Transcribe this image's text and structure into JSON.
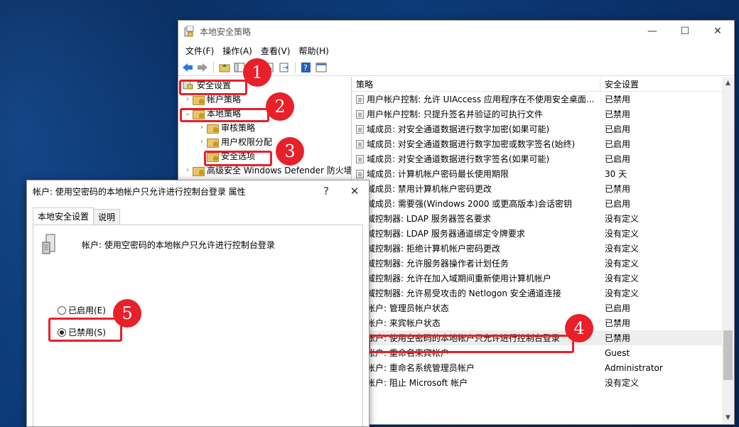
{
  "window": {
    "title": "本地安全策略",
    "minimize": "—",
    "maximize": "☐",
    "close": "✕"
  },
  "menu": [
    "文件(F)",
    "操作(A)",
    "查看(V)",
    "帮助(H)"
  ],
  "tree": {
    "root": "安全设置",
    "account_policy": "帐户策略",
    "local_policy": "本地策略",
    "audit_policy": "审核策略",
    "user_rights": "用户权限分配",
    "security_options": "安全选项",
    "firewall": "高级安全 Windows Defender 防火墙"
  },
  "list": {
    "header_policy": "策略",
    "header_setting": "安全设置",
    "rows": [
      {
        "policy": "用户帐户控制: 允许 UIAccess 应用程序在不使用安全桌面...",
        "setting": "已禁用"
      },
      {
        "policy": "用户帐户控制: 只提升签名并验证的可执行文件",
        "setting": "已禁用"
      },
      {
        "policy": "域成员: 对安全通道数据进行数字加密(如果可能)",
        "setting": "已启用"
      },
      {
        "policy": "域成员: 对安全通道数据进行数字加密或数字签名(始终)",
        "setting": "已启用"
      },
      {
        "policy": "域成员: 对安全通道数据进行数字签名(如果可能)",
        "setting": "已启用"
      },
      {
        "policy": "域成员: 计算机帐户密码最长使用期限",
        "setting": "30 天"
      },
      {
        "policy": "域成员: 禁用计算机帐户密码更改",
        "setting": "已禁用"
      },
      {
        "policy": "域成员: 需要强(Windows 2000 或更高版本)会话密钥",
        "setting": "已启用"
      },
      {
        "policy": "域控制器: LDAP 服务器签名要求",
        "setting": "没有定义"
      },
      {
        "policy": "域控制器: LDAP 服务器通道绑定令牌要求",
        "setting": "没有定义"
      },
      {
        "policy": "域控制器: 拒绝计算机帐户密码更改",
        "setting": "没有定义"
      },
      {
        "policy": "域控制器: 允许服务器操作者计划任务",
        "setting": "没有定义"
      },
      {
        "policy": "域控制器:  允许在加入域期间重新使用计算机帐户",
        "setting": "没有定义"
      },
      {
        "policy": "域控制器:  允许易受攻击的 Netlogon 安全通道连接",
        "setting": "没有定义"
      },
      {
        "policy": "帐户: 管理员帐户状态",
        "setting": "已启用"
      },
      {
        "policy": "帐户: 来宾帐户状态",
        "setting": "已禁用"
      },
      {
        "policy": "帐户: 使用空密码的本地帐户只允许进行控制台登录",
        "setting": "已禁用"
      },
      {
        "policy": "帐户: 重命名来宾帐户",
        "setting": "Guest"
      },
      {
        "policy": "帐户: 重命名系统管理员帐户",
        "setting": "Administrator"
      },
      {
        "policy": "帐户: 阻止 Microsoft 帐户",
        "setting": "没有定义"
      }
    ]
  },
  "dialog": {
    "title": "帐户: 使用空密码的本地帐户只允许进行控制台登录 属性",
    "help": "?",
    "close": "✕",
    "tab_local": "本地安全设置",
    "tab_explain": "说明",
    "description": "帐户: 使用空密码的本地帐户只允许进行控制台登录",
    "option_enabled": "已启用(E)",
    "option_disabled": "已禁用(S)",
    "selected": "option_disabled"
  },
  "badges": [
    "1",
    "2",
    "3",
    "4",
    "5"
  ],
  "colors": {
    "annotation_red": "#e8202a",
    "folder": "#e9c46a"
  }
}
